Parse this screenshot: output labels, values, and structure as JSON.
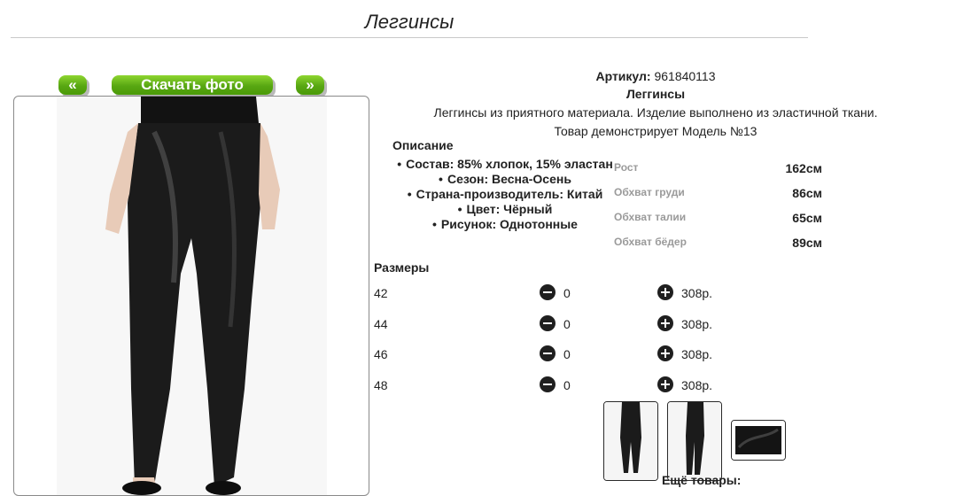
{
  "page": {
    "title": "Леггинсы"
  },
  "gallery": {
    "prev_label": "«",
    "download_label": "Скачать фото",
    "next_label": "»"
  },
  "product": {
    "sku_label": "Артикул:",
    "sku_value": "961840113",
    "name": "Леггинсы",
    "description": "Леггинсы из приятного материала. Изделие выполнено из эластичной ткани.",
    "model_note": "Товар демонстрирует Модель №13"
  },
  "details": {
    "title": "Описание",
    "attributes": [
      "Состав: 85% хлопок, 15% эластан",
      "Сезон: Весна-Осень",
      "Страна-производитель: Китай",
      "Цвет: Чёрный",
      "Рисунок: Однотонные"
    ]
  },
  "model_measurements": [
    {
      "label": "Рост",
      "value": "162см"
    },
    {
      "label": "Обхват груди",
      "value": "86см"
    },
    {
      "label": "Обхват талии",
      "value": "65см"
    },
    {
      "label": "Обхват бёдер",
      "value": "89см"
    }
  ],
  "sizes": {
    "title": "Размеры",
    "rows": [
      {
        "size": "42",
        "qty": "0",
        "price": "308р."
      },
      {
        "size": "44",
        "qty": "0",
        "price": "308р."
      },
      {
        "size": "46",
        "qty": "0",
        "price": "308р."
      },
      {
        "size": "48",
        "qty": "0",
        "price": "308р."
      }
    ]
  },
  "more_products_label": "Ещё товары:",
  "colors": {
    "button_green": "#58a712",
    "icon_dark": "#1f1f1f",
    "muted_label": "#9a9a9a"
  }
}
